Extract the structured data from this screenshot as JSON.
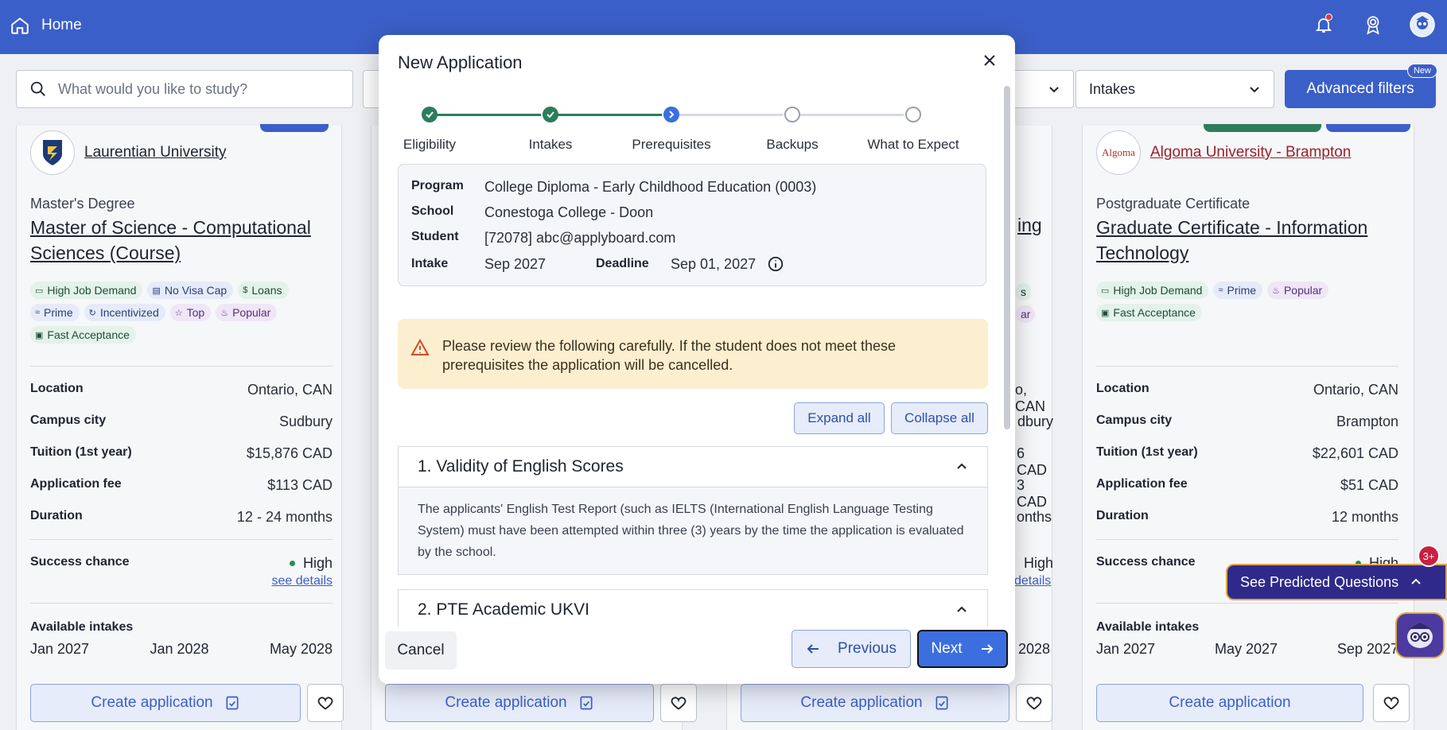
{
  "topbar": {
    "home_label": "Home"
  },
  "filters": {
    "search_placeholder": "What would you like to study?",
    "intakes_label": "Intakes",
    "advanced_label": "Advanced filters",
    "new_badge": "New"
  },
  "cards": [
    {
      "university": "Laurentian University",
      "degree": "Master's Degree",
      "program": "Master of Science - Computational Sciences (Course)",
      "tags": [
        "High Job Demand",
        "No Visa Cap",
        "Loans",
        "Prime",
        "Incentivized",
        "Top",
        "Popular",
        "Fast Acceptance"
      ],
      "location": "Ontario, CAN",
      "campus": "Sudbury",
      "tuition": "$15,876 CAD",
      "fee": "$113 CAD",
      "duration": "12 - 24 months",
      "success": "High",
      "intakes": [
        "Jan 2027",
        "Jan 2028",
        "May 2028"
      ]
    },
    {
      "university": "Algoma University - Brampton",
      "degree": "Postgraduate Certificate",
      "program": "Graduate Certificate - Information Technology",
      "tags": [
        "High Job Demand",
        "Prime",
        "Popular",
        "Fast Acceptance"
      ],
      "location": "Ontario, CAN",
      "campus": "Brampton",
      "tuition": "$22,601 CAD",
      "fee": "$51 CAD",
      "duration": "12 months",
      "success": "High",
      "intakes": [
        "Jan 2027",
        "May 2027",
        "Sep 2027"
      ]
    }
  ],
  "partial": {
    "ing": "ing",
    "s": "s",
    "ar": "ar",
    "can": "o, CAN",
    "bury": "dbury",
    "cad1": "6 CAD",
    "cad2": "3 CAD",
    "onths": "onths",
    "high": "High",
    "details": "details",
    "i2028": "2028"
  },
  "labels": {
    "location": "Location",
    "campus": "Campus city",
    "tuition": "Tuition (1st year)",
    "fee": "Application fee",
    "duration": "Duration",
    "success": "Success chance",
    "see_details": "see details",
    "available": "Available intakes",
    "create": "Create application"
  },
  "modal": {
    "title": "New Application",
    "steps": [
      {
        "label": "Eligibility",
        "state": "done"
      },
      {
        "label": "Intakes",
        "state": "done"
      },
      {
        "label": "Prerequisites",
        "state": "current"
      },
      {
        "label": "Backups",
        "state": "todo"
      },
      {
        "label": "What to Expect",
        "state": "todo"
      }
    ],
    "info": {
      "program_label": "Program",
      "program": "College Diploma - Early Childhood Education (0003)",
      "school_label": "School",
      "school": "Conestoga College - Doon",
      "student_label": "Student",
      "student": "[72078] abc@applyboard.com",
      "intake_label": "Intake",
      "intake": "Sep 2027",
      "deadline_label": "Deadline",
      "deadline": "Sep 01, 2027"
    },
    "warning": "Please review the following carefully. If the student does not meet these prerequisites the application will be cancelled.",
    "expand_all": "Expand all",
    "collapse_all": "Collapse all",
    "sections": [
      {
        "title": "1. Validity of English Scores",
        "body": "The applicants' English Test Report (such as IELTS (International English Language Testing System) must have been attempted within three (3) years by the time the application is evaluated by the school."
      },
      {
        "title": "2. PTE Academic UKVI"
      }
    ],
    "cancel": "Cancel",
    "previous": "Previous",
    "next": "Next"
  },
  "assistant": {
    "predicted": "See Predicted Questions",
    "badge": "3+"
  }
}
